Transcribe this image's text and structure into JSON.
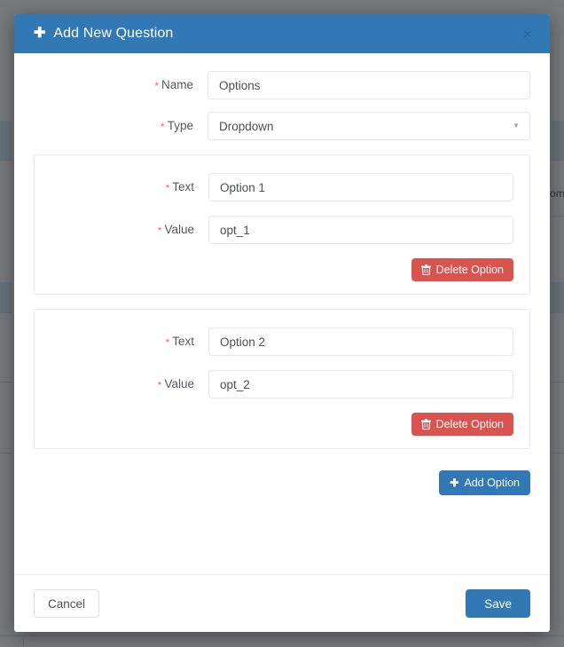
{
  "background": {
    "visible_text_fragment": "omis"
  },
  "modal": {
    "title": "Add New Question",
    "title_icon": "plus-icon",
    "close_icon": "close-icon",
    "close_label": "×",
    "accent_color": "#3178b4",
    "danger_color": "#d9534f",
    "fields": [
      {
        "label": "Name",
        "required_marker": "*",
        "value": "Options",
        "type": "text"
      },
      {
        "label": "Type",
        "required_marker": "*",
        "value": "Dropdown",
        "type": "select",
        "caret_icon": "chevron-down-icon"
      }
    ],
    "options": [
      {
        "text_label": "Text",
        "text_value": "Option 1",
        "value_label": "Value",
        "value_value": "opt_1",
        "delete_label": "Delete Option",
        "delete_icon": "trash-icon",
        "required_marker": "*"
      },
      {
        "text_label": "Text",
        "text_value": "Option 2",
        "value_label": "Value",
        "value_value": "opt_2",
        "delete_label": "Delete Option",
        "delete_icon": "trash-icon",
        "required_marker": "*"
      }
    ],
    "add_option_label": "Add Option",
    "add_option_icon": "plus-icon",
    "footer": {
      "cancel_label": "Cancel",
      "save_label": "Save"
    }
  }
}
